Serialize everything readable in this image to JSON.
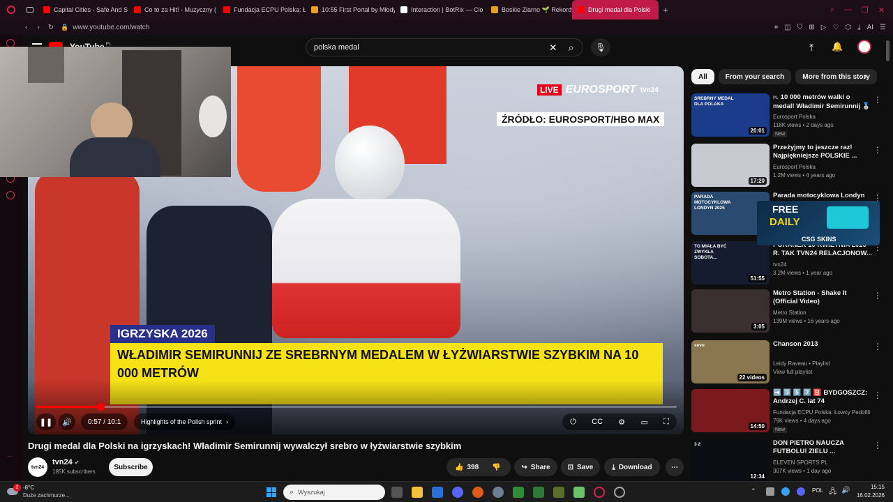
{
  "browser": {
    "tabs": [
      {
        "title": "Capital Cities - Safe And S",
        "color": "#ff0000"
      },
      {
        "title": "Co to za Hit! - Muzyczny (",
        "color": "#ff0000"
      },
      {
        "title": "Fundacja ECPU Polska: Ło",
        "color": "#ff0000"
      },
      {
        "title": "10:55 First Portal by Młody",
        "color": "#f0a020"
      },
      {
        "title": "Interaction | BotRix — Clo",
        "color": "#ffffff"
      },
      {
        "title": "Boskie Ziarno 🌱 Rekordy",
        "color": "#e8a020"
      },
      {
        "title": "Drugi medal dla Polski",
        "color": "#ff0000"
      }
    ],
    "url": "www.youtube.com/watch"
  },
  "youtube": {
    "logo": "YouTube",
    "region": "PL",
    "search_value": "polska medal"
  },
  "video": {
    "live_badge": "LIVE",
    "channel_bug": "EUROSPORT",
    "channel_bug_sub": "tvn24",
    "source": "ŹRÓDŁO: EUROSPORT/HBO MAX",
    "lower_third_tag": "IGRZYSKA 2026",
    "lower_third_text": "WŁADIMIR SEMIRUNNIJ ZE SREBRNYM MEDALEM W ŁYŻWIARSTWIE SZYBKIM NA 10 000 METRÓW",
    "time": "0:57 / 10:1",
    "chapter": "Highlights of the Polish sprint",
    "progress": 0.1,
    "title": "Drugi medal dla Polski na igrzyskach! Władimir Semirunnij wywalczył srebro w łyżwiarstwie szybkim",
    "channel": "tvn24",
    "channel_avatar": "tvn24",
    "subscribers": "185K subscribers",
    "subscribe": "Subscribe",
    "likes": "398",
    "share": "Share",
    "save": "Save",
    "download": "Download"
  },
  "chips": [
    "All",
    "From your search",
    "More from this story"
  ],
  "recommendations": [
    {
      "title": "10 000 metrów walki o medal! Władimir Semirunnij 🥈",
      "prefix": "PL",
      "channel": "Eurosport Polska",
      "meta": "118K views • 2 days ago",
      "badge": "New",
      "duration": "20:01",
      "thumb_text": "SREBRNY MEDAL DLA POLAKA",
      "thumb": "#1a3c8a"
    },
    {
      "title": "Przeżyjmy to jeszcze raz! Najpiękniejsze POLSKIE ...",
      "channel": "Eurosport Polska",
      "meta": "1.2M views • 4 years ago",
      "duration": "17:20",
      "thumb_text": "",
      "thumb": "#c8c8d0"
    },
    {
      "title": "Parada motocyklowa Londyn",
      "channel": "",
      "meta": "",
      "duration": "",
      "thumb_text": "PARADA MOTOCYKLOWA LONDYN 2025",
      "thumb": "#2b4a70"
    },
    {
      "title": "PORANEK 10 KWIETNIA 2010 R. TAK TVN24 RELACJONOW...",
      "channel": "tvn24",
      "meta": "3.2M views • 1 year ago",
      "duration": "51:55",
      "thumb_text": "TO MIAŁA BYĆ ZWYKŁA SOBOTA...",
      "thumb": "#151c30"
    },
    {
      "title": "Metro Station - Shake It (Official Video)",
      "channel": "Metro Station",
      "meta": "139M views • 16 years ago",
      "duration": "3:05",
      "thumb_text": "",
      "thumb": "#3a3032"
    },
    {
      "title": "Chanson 2013",
      "channel": "Leidy Raveau • Playlist",
      "meta": "View full playlist",
      "duration": "22 videos",
      "thumb_text": "vevo",
      "thumb": "#8a7650"
    },
    {
      "title": "➡️ 3️⃣ 5️⃣ 7️⃣ 🅱️ BYDGOSZCZ: Andrzej C. lat 74",
      "channel": "Fundacja ECPU Polska: Łowcy Pedofili",
      "meta": "79K views • 4 days ago",
      "badge": "New",
      "duration": "14:50",
      "thumb_text": "",
      "thumb": "#7a1a1e"
    },
    {
      "title": "DON PIETRO NAUCZA FUTBOLU! ZIELU ...",
      "channel": "ELEVEN SPORTS PL",
      "meta": "307K views • 1 day ago",
      "duration": "12:34",
      "thumb_text": "3 2",
      "thumb": "#0c0c14"
    }
  ],
  "ad": {
    "line1": "FREE",
    "line2": "DAILY",
    "brand": "CSG SKINS"
  },
  "taskbar": {
    "temp": "-8°C",
    "weather": "Duże zachmurze...",
    "notif": "2",
    "search_placeholder": "Wyszukaj",
    "lang": "POL",
    "time": "15:15",
    "date": "16.02.2026"
  }
}
